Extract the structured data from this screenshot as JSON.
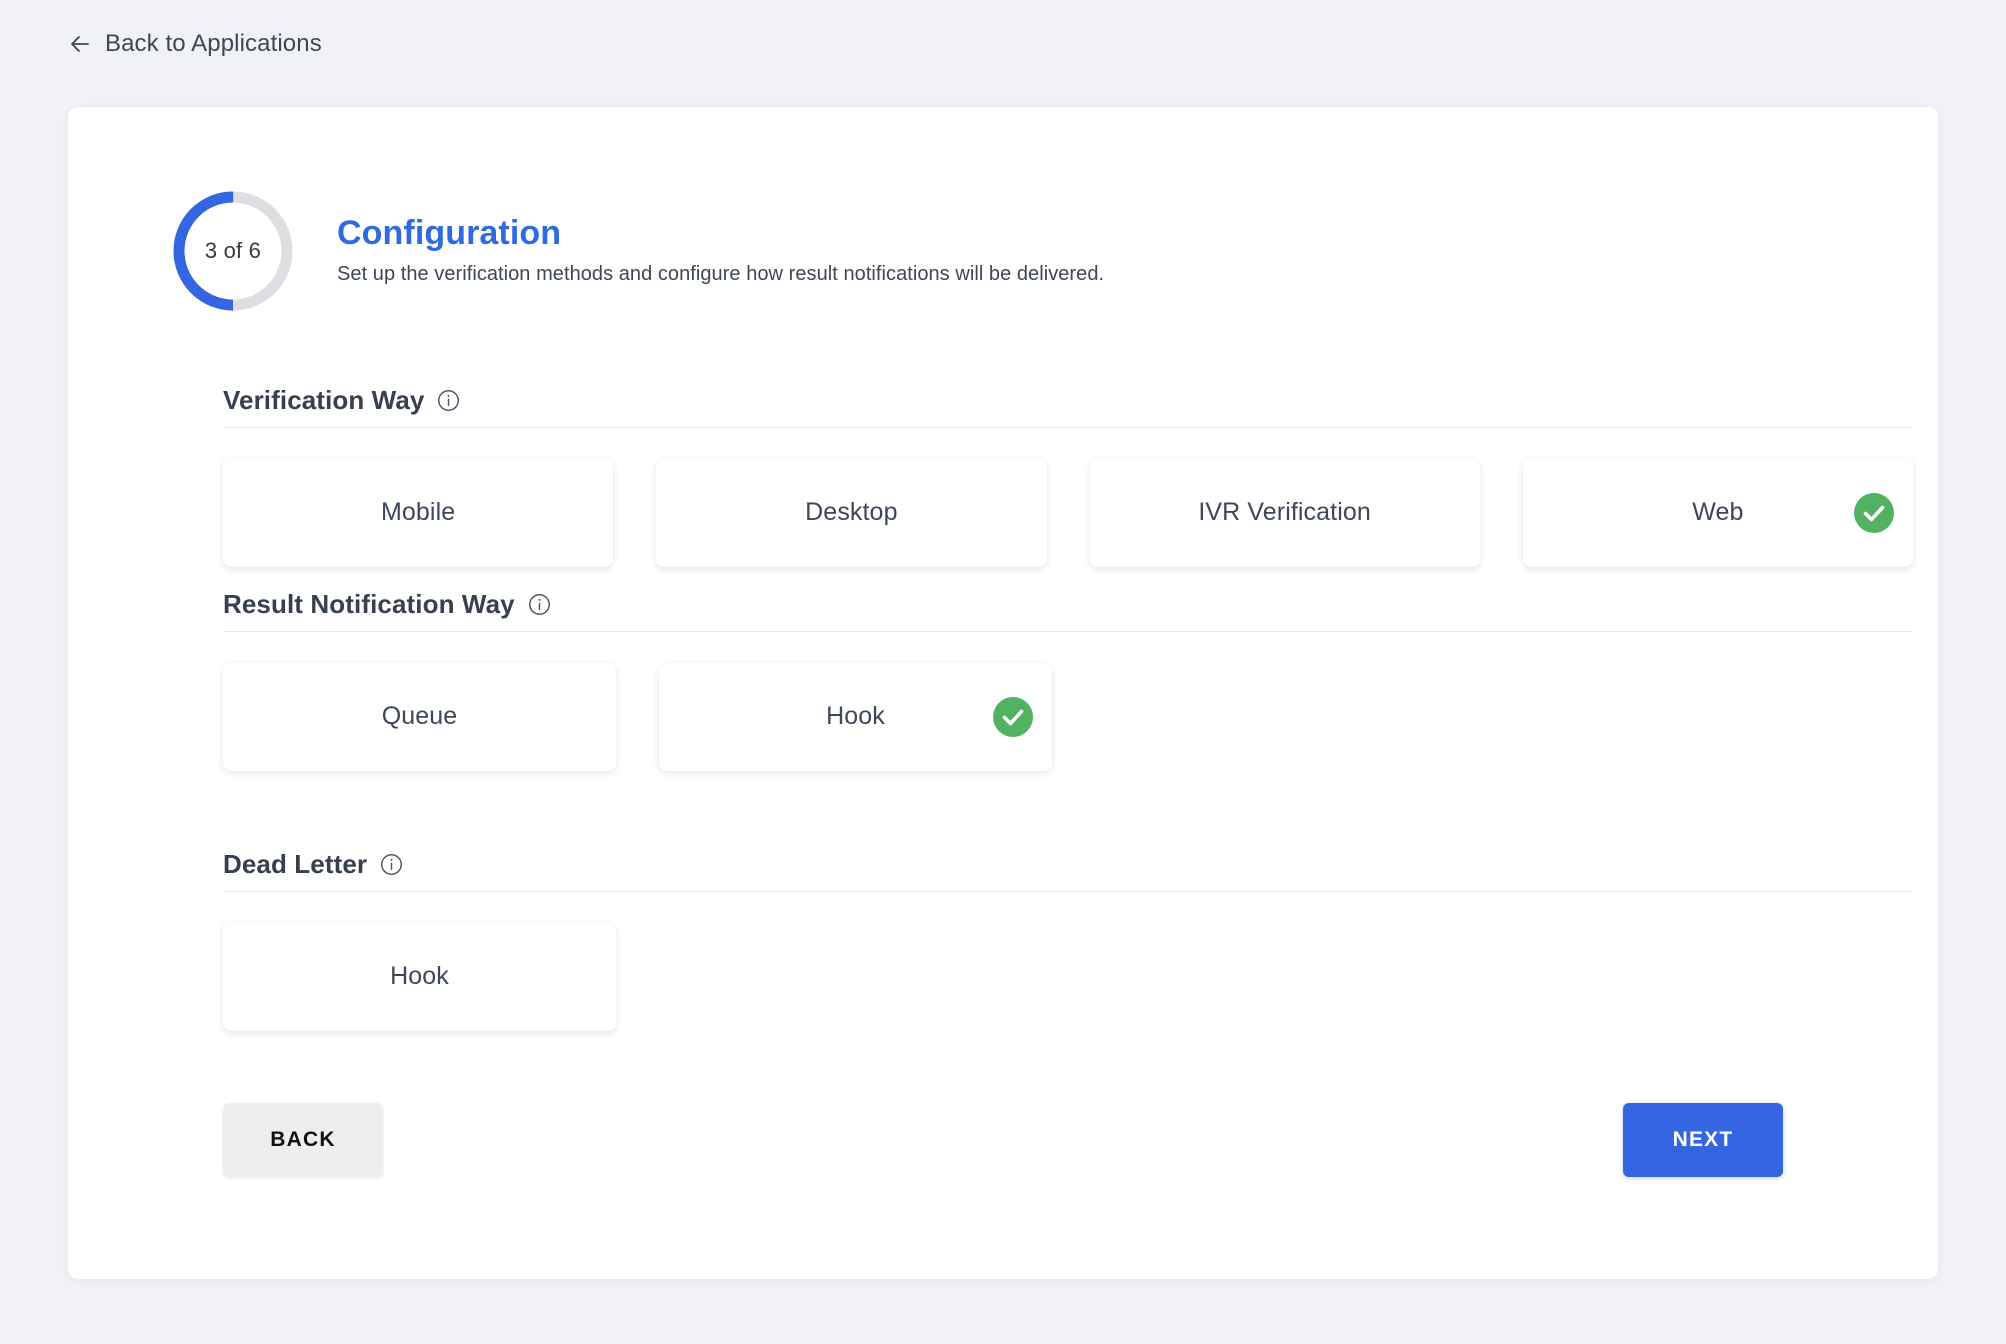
{
  "nav": {
    "back_link_label": "Back to Applications"
  },
  "header": {
    "progress_label": "3 of 6",
    "progress_current": 3,
    "progress_total": 6,
    "title": "Configuration",
    "subtitle": "Set up the verification methods and configure how result notifications will be delivered.",
    "accent_color": "#2f6be0",
    "ring_track_color": "#dcdee1"
  },
  "sections": [
    {
      "title": "Verification Way",
      "info_icon": "info-circle-icon",
      "options": [
        {
          "label": "Mobile",
          "selected": false
        },
        {
          "label": "Desktop",
          "selected": false
        },
        {
          "label": "IVR Verification",
          "selected": false
        },
        {
          "label": "Web",
          "selected": true
        }
      ]
    },
    {
      "title": "Result Notification Way",
      "info_icon": "info-circle-icon",
      "options": [
        {
          "label": "Queue",
          "selected": false
        },
        {
          "label": "Hook",
          "selected": true
        }
      ]
    },
    {
      "title": "Dead Letter",
      "info_icon": "info-circle-icon",
      "options": [
        {
          "label": "Hook",
          "selected": false
        }
      ]
    }
  ],
  "footer": {
    "back_label": "BACK",
    "next_label": "NEXT",
    "next_color": "#3366e0",
    "back_color": "#eeeeee"
  },
  "theme": {
    "page_background": "#f1f2f6",
    "card_background": "#ffffff",
    "text_color": "#3d4757",
    "selected_badge_color": "#52b261"
  }
}
